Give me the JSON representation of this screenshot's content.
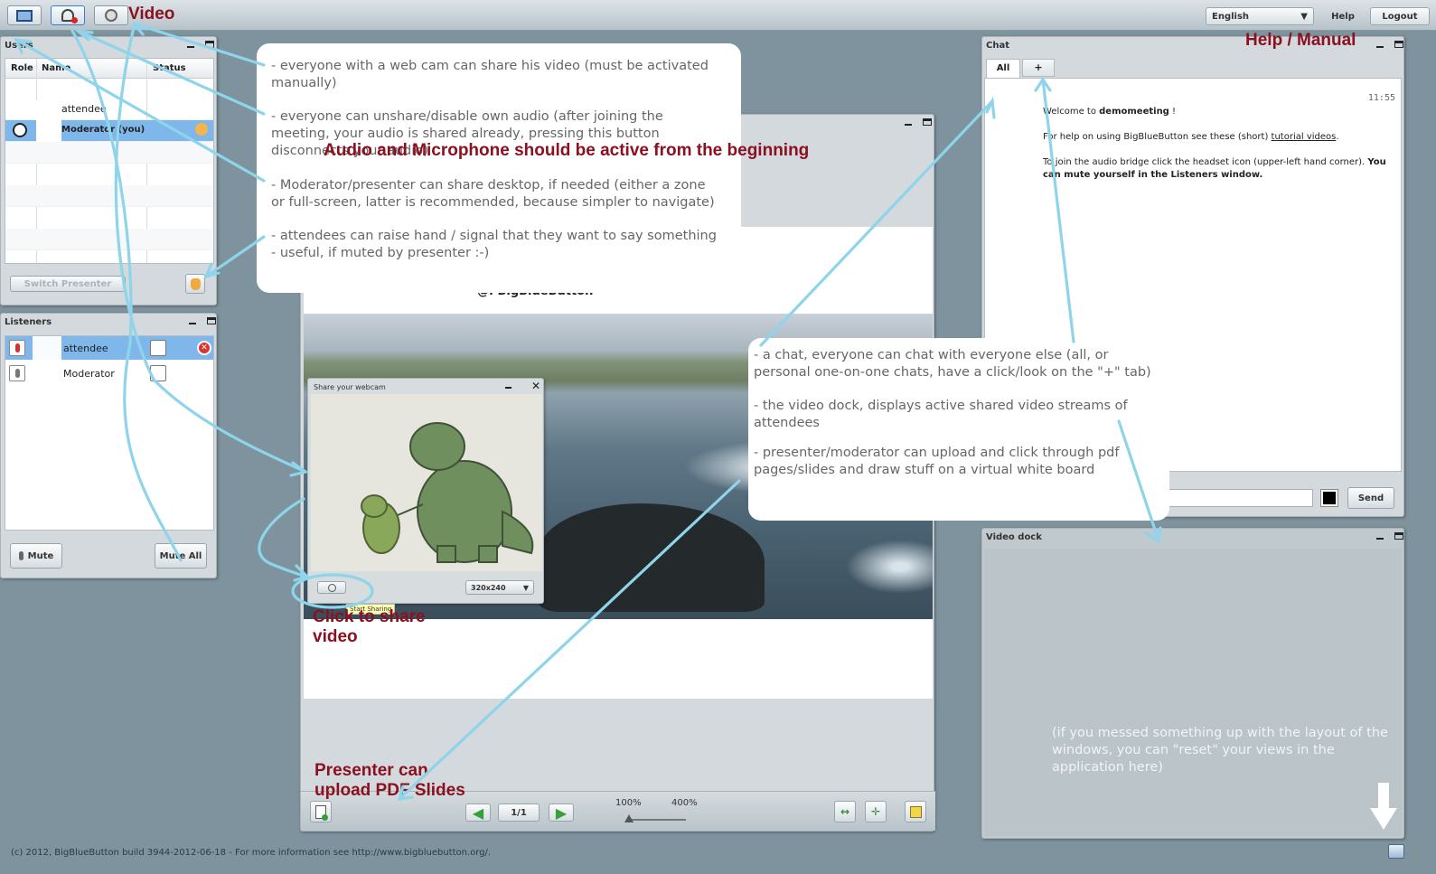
{
  "topbar": {
    "language": "English",
    "help": "Help",
    "logout": "Logout"
  },
  "annotations": {
    "video": "Video",
    "help_manual": "Help / Manual",
    "audio_mic": "Audio and Microphone should be active from the beginning",
    "click_share_1": "Click to share",
    "click_share_2": "video",
    "presenter_upload_1": "Presenter can",
    "presenter_upload_2": "upload PDF Slides"
  },
  "callout_left": {
    "p1": "- everyone with a web cam can share his video (must be activated manually)",
    "p2a": "- everyone can unshare/disable own audio (after joining the meeting, your audio is shared already, pressing this button disconnects your audio)",
    "p3": "- Moderator/presenter can share desktop, if needed (either a zone or full-screen, latter is recommended, because simpler to navigate)",
    "p4": "- attendees can raise hand / signal that they want to say something - useful, if muted by presenter :-)"
  },
  "callout_right": {
    "p1": "- a chat, everyone can chat with everyone else (all, or personal one-on-one chats, have a click/look on the \"+\" tab)",
    "p2": "- the video dock, displays active shared video streams of attendees",
    "p3": "- presenter/moderator can upload and click through pdf pages/slides and draw stuff on a virtual white board"
  },
  "reset_note": "(if you messed something up with the layout of the windows, you can \"reset\" your views in the application here)",
  "users": {
    "title": "Users",
    "columns": [
      "Role",
      "Name",
      "Status"
    ],
    "rows": [
      {
        "name": "attendee"
      },
      {
        "name": "Moderator (you)"
      }
    ],
    "switch_presenter": "Switch Presenter"
  },
  "listeners": {
    "title": "Listeners",
    "rows": [
      {
        "name": "attendee"
      },
      {
        "name": "Moderator"
      }
    ],
    "mute": "Mute",
    "mute_all": "Mute All"
  },
  "presentation": {
    "slide_text": "@. BigBlueButton",
    "page": "1/1",
    "zoom_min": "100%",
    "zoom_max": "400%"
  },
  "webcam": {
    "title": "Share your webcam",
    "resolution": "320x240",
    "tooltip": "Start Sharing"
  },
  "chat": {
    "title": "Chat",
    "tab_all": "All",
    "tab_plus": "+",
    "time": "11:55",
    "welcome_prefix": "Welcome to ",
    "meeting": "demomeeting",
    "welcome_suffix": " !",
    "help_text": "For help on using BigBlueButton see these (short) ",
    "help_link": "tutorial videos",
    "audio_text": "To join the audio bridge click the headset icon (upper-left hand corner). ",
    "audio_bold": "You can mute yourself in the Listeners window.",
    "send": "Send"
  },
  "video_dock": {
    "title": "Video dock"
  },
  "footer": "(c) 2012, BigBlueButton build 3944-2012-06-18 - For more information see http://www.bigbluebutton.org/."
}
